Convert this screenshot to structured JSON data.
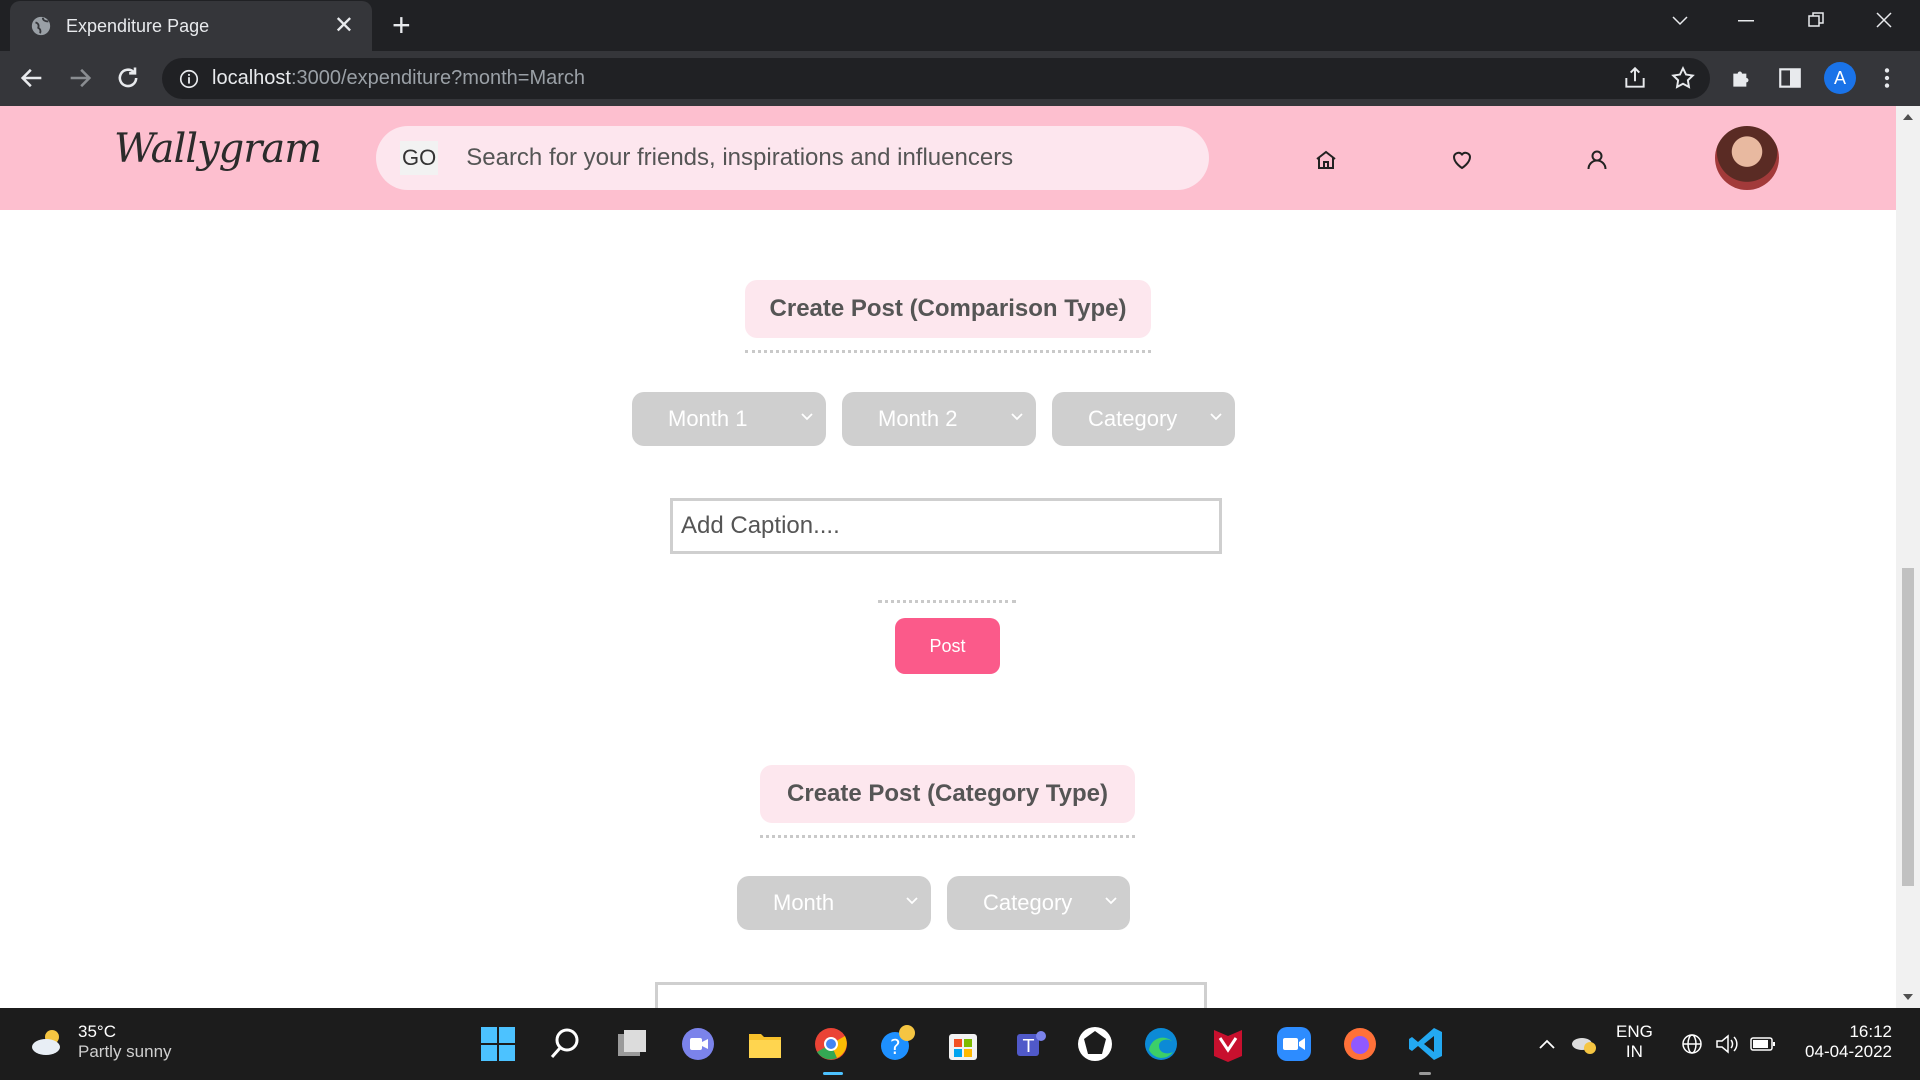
{
  "browser": {
    "tab_title": "Expenditure Page",
    "url_host": "localhost",
    "url_rest": ":3000/expenditure?month=March",
    "profile_initial": "A"
  },
  "header": {
    "logo": "Wallygram",
    "search_go": "GO",
    "search_placeholder": "Search for your friends, inspirations and influencers"
  },
  "comparison": {
    "title": "Create Post (Comparison Type)",
    "month1": "Month 1",
    "month2": "Month 2",
    "category": "Category",
    "caption_placeholder": "Add Caption....",
    "post_label": "Post"
  },
  "category_post": {
    "title": "Create Post (Category Type)",
    "month": "Month",
    "category": "Category"
  },
  "taskbar": {
    "temperature": "35°C",
    "condition": "Partly sunny",
    "lang_top": "ENG",
    "lang_bottom": "IN",
    "time": "16:12",
    "date": "04-04-2022"
  },
  "colors": {
    "header_bg": "#fdbfcf",
    "post_button": "#fb5a8a",
    "select_bg": "#cfcfcf"
  }
}
